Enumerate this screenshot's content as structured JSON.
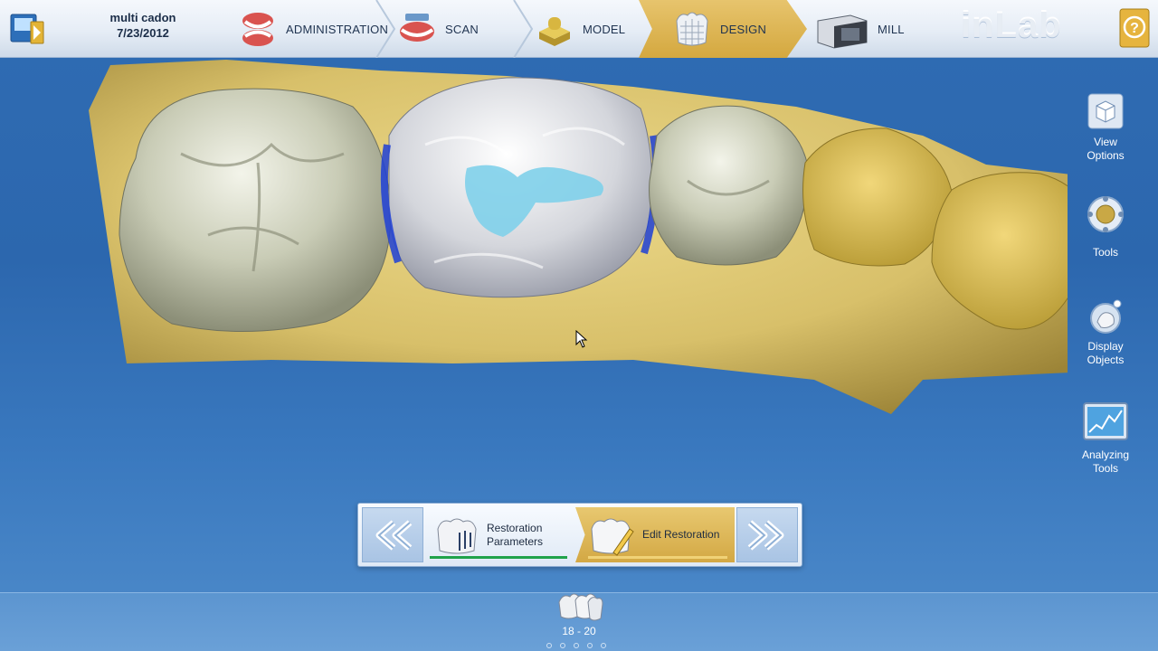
{
  "header": {
    "case_name": "multi cadon",
    "case_date": "7/23/2012",
    "brand": "inLab",
    "steps": [
      {
        "label": "ADMINISTRATION",
        "icon": "dentures-icon"
      },
      {
        "label": "SCAN",
        "icon": "scan-dentures-icon"
      },
      {
        "label": "MODEL",
        "icon": "model-icon"
      },
      {
        "label": "DESIGN",
        "icon": "crown-design-icon",
        "active": true
      },
      {
        "label": "MILL",
        "icon": "milling-machine-icon"
      }
    ],
    "active_step": "DESIGN"
  },
  "sidebar": {
    "tools": [
      {
        "label_line1": "View",
        "label_line2": "Options",
        "icon": "view-options-cube-icon"
      },
      {
        "label_line1": "Tools",
        "label_line2": "",
        "icon": "tools-wheel-icon"
      },
      {
        "label_line1": "Display",
        "label_line2": "Objects",
        "icon": "display-objects-icon"
      },
      {
        "label_line1": "Analyzing",
        "label_line2": "Tools",
        "icon": "analyzing-tools-icon"
      }
    ]
  },
  "phase_nav": {
    "back_icon": "double-chevron-left-icon",
    "next_icon": "double-chevron-right-icon",
    "steps": [
      {
        "label_line1": "Restoration",
        "label_line2": "Parameters",
        "progress_color": "#1fa24a",
        "progress": 1.0
      },
      {
        "label_line1": "Edit Restoration",
        "label_line2": "",
        "progress_color": "#e8c04a",
        "progress": 1.0,
        "active": true
      }
    ]
  },
  "restoration": {
    "range": "18 - 20",
    "page_count": 5
  },
  "colors": {
    "background": "#2f6cb3",
    "accent_gold": "#d4a83f",
    "model_stone": "#d8c06a",
    "restoration_gray": "#d4d6dc",
    "contact_blue": "#1f3fd6",
    "occlusal_cyan": "#7fd0ea"
  }
}
